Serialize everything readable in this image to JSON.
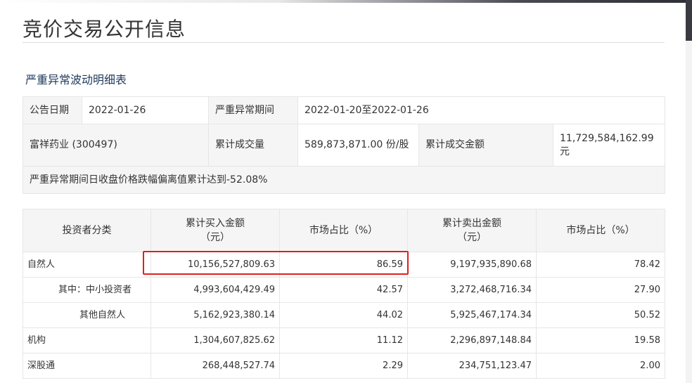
{
  "page": {
    "title": "竞价交易公开信息",
    "subtitle": "严重异常波动明细表"
  },
  "info": {
    "announce_date_label": "公告日期",
    "announce_date_value": "2022-01-26",
    "period_label": "严重异常期间",
    "period_value": "2022-01-20至2022-01-26",
    "stock_name": "富祥药业 (300497)",
    "volume_label": "累计成交量",
    "volume_value": "589,873,871.00 份/股",
    "amount_label": "累计成交金额",
    "amount_value": "11,729,584,162.99元",
    "deviation_text": "严重异常期间日收盘价格跌幅偏离值累计达到-52.08%"
  },
  "table": {
    "headers": {
      "category": "投资者分类",
      "buy_amount_l1": "累计买入金额",
      "buy_amount_l2": "（元）",
      "buy_share": "市场占比（%）",
      "sell_amount_l1": "累计卖出金额",
      "sell_amount_l2": "（元）",
      "sell_share": "市场占比（%）"
    },
    "rows": [
      {
        "category": "自然人",
        "buy": "10,156,527,809.63",
        "buy_pct": "86.59",
        "sell": "9,197,935,890.68",
        "sell_pct": "78.42"
      },
      {
        "category": "其中：中小投资者",
        "buy": "4,993,604,429.49",
        "buy_pct": "42.57",
        "sell": "3,272,468,716.34",
        "sell_pct": "27.90"
      },
      {
        "category": "其他自然人",
        "buy": "5,162,923,380.14",
        "buy_pct": "44.02",
        "sell": "5,925,467,174.34",
        "sell_pct": "50.52"
      },
      {
        "category": "机构",
        "buy": "1,304,607,825.62",
        "buy_pct": "11.12",
        "sell": "2,296,897,148.84",
        "sell_pct": "19.58"
      },
      {
        "category": "深股通",
        "buy": "268,448,527.74",
        "buy_pct": "2.29",
        "sell": "234,751,123.47",
        "sell_pct": "2.00"
      }
    ]
  },
  "colors": {
    "highlight": "#e0201a",
    "label_bg": "#f5f5f5",
    "subtitle": "#1f3a5c"
  }
}
